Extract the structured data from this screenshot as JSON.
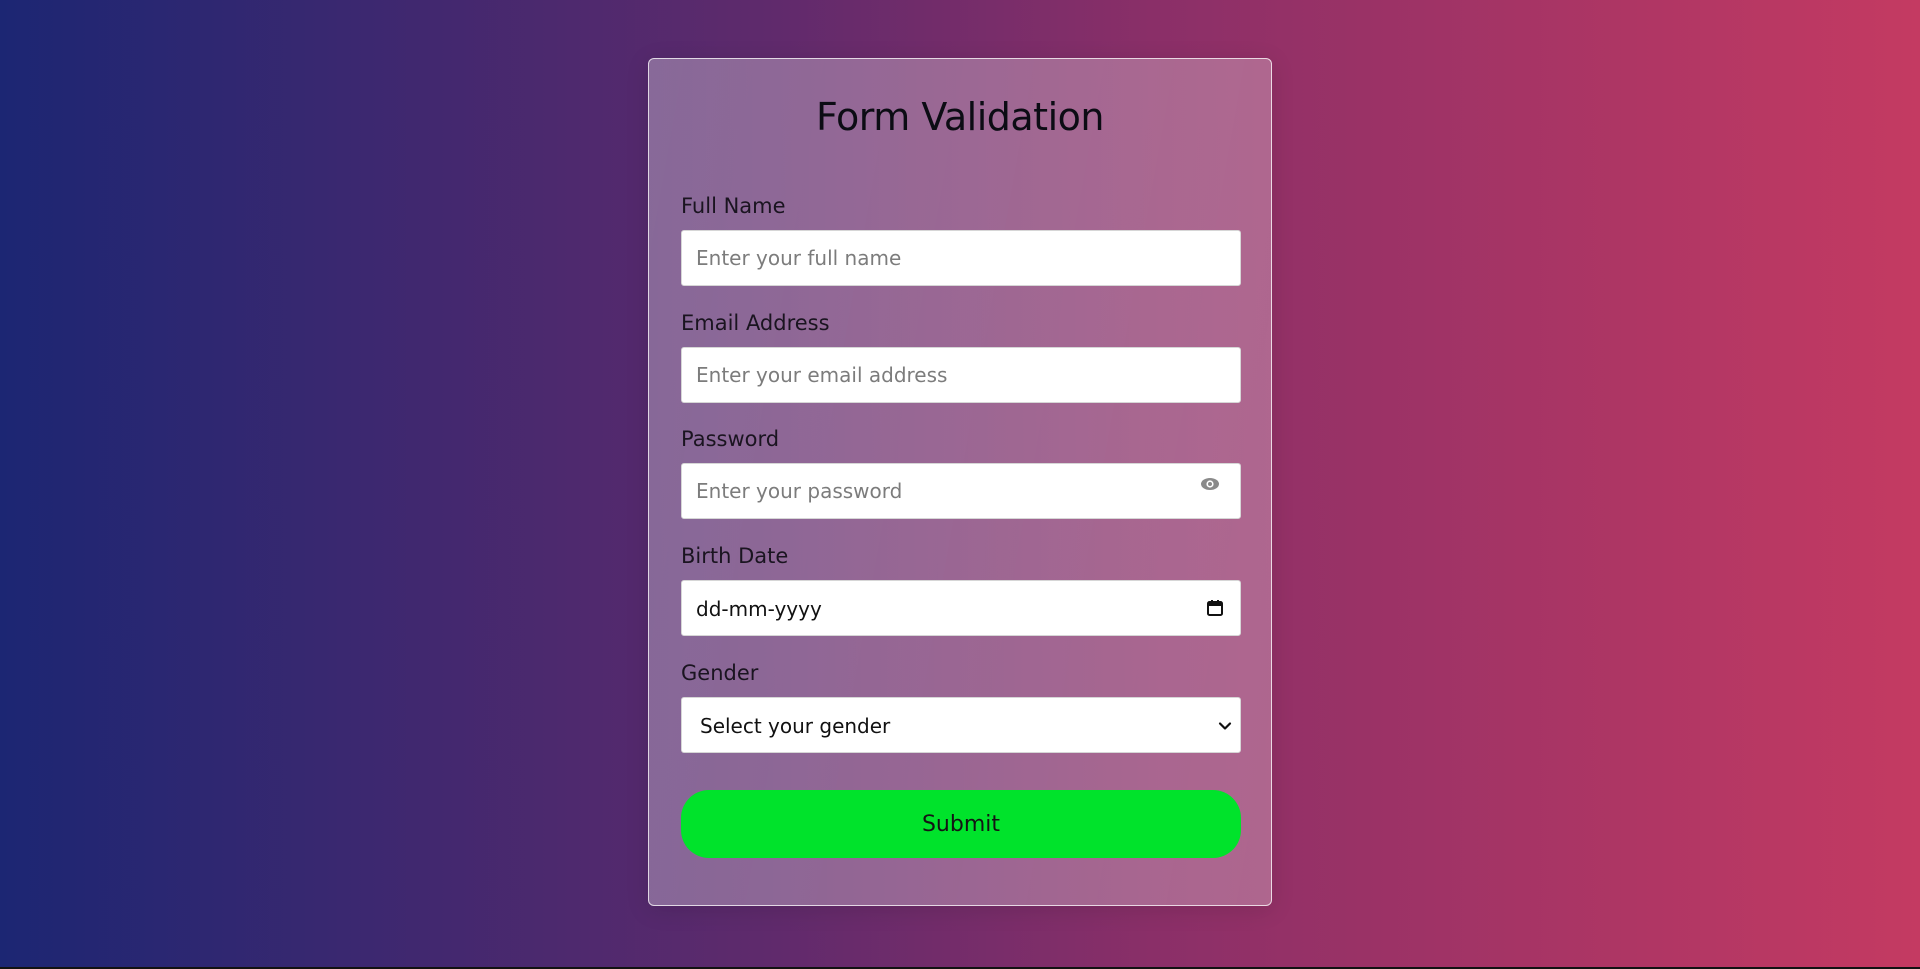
{
  "form": {
    "title": "Form Validation",
    "fields": {
      "full_name": {
        "label": "Full Name",
        "placeholder": "Enter your full name",
        "value": ""
      },
      "email": {
        "label": "Email Address",
        "placeholder": "Enter your email address",
        "value": ""
      },
      "password": {
        "label": "Password",
        "placeholder": "Enter your password",
        "value": "",
        "toggle_icon": "eye-icon"
      },
      "birth_date": {
        "label": "Birth Date",
        "display_value": "dd-mm-yyyy",
        "icon": "calendar-icon"
      },
      "gender": {
        "label": "Gender",
        "selected": "Select your gender",
        "icon": "chevron-down-icon"
      }
    },
    "submit_label": "Submit"
  },
  "colors": {
    "submit_bg": "#00e32b",
    "bg_start": "#1c2673",
    "bg_end": "#c43a62"
  }
}
